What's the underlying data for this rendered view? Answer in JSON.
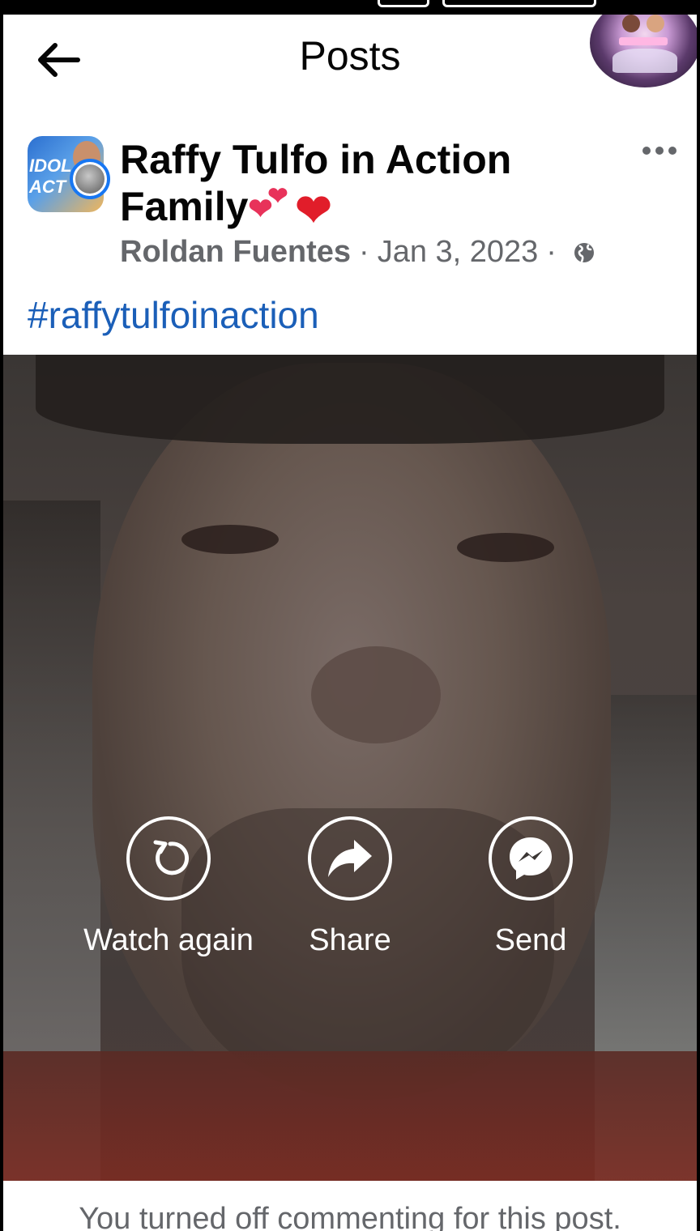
{
  "header": {
    "title": "Posts",
    "back_icon": "arrow-left-icon"
  },
  "chat_bubble": {
    "icon": "chat-head-avatar"
  },
  "post": {
    "group_name": "Raffy Tulfo in Action Family",
    "group_emojis": [
      "💕",
      "❤"
    ],
    "group_avatar_text": "IDOL ACT",
    "author": "Roldan Fuentes",
    "separator": "·",
    "date": "Jan 3, 2023",
    "privacy_icon": "globe-icon",
    "more_icon": "more-dots-icon",
    "hashtag": "#raffytulfoinaction"
  },
  "video": {
    "actions": [
      {
        "label": "Watch again",
        "icon": "replay-icon"
      },
      {
        "label": "Share",
        "icon": "share-arrow-icon"
      },
      {
        "label": "Send",
        "icon": "messenger-icon"
      }
    ]
  },
  "comments": {
    "notice": "You turned off commenting for this post."
  },
  "colors": {
    "link": "#1b5fb8",
    "meta_gray": "#65676b",
    "accent_blue": "#1877f2",
    "heart_red": "#e11d2a",
    "heart_pink": "#e8325a"
  }
}
